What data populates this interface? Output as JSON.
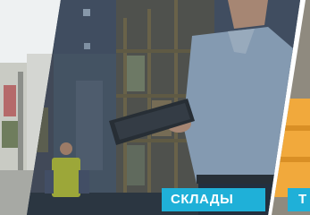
{
  "slides": [
    {
      "id": "left",
      "caption": ""
    },
    {
      "id": "center",
      "caption": "СКЛАДЫ"
    },
    {
      "id": "right",
      "caption": "Т"
    }
  ],
  "colors": {
    "label_bg": "#1fb0d8",
    "overlay": "#2b3a49",
    "right_accent": "#f1a93c"
  }
}
